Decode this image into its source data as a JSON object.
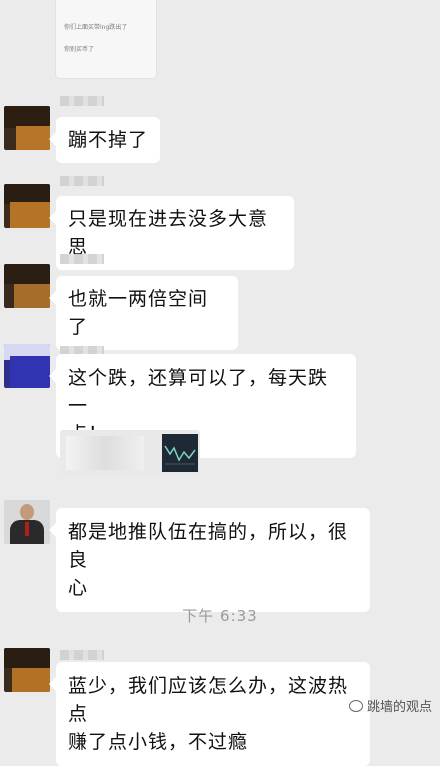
{
  "top_image": {
    "line1": "你们上面买带ing跌出了",
    "line2": "你别买币了"
  },
  "messages": [
    {
      "text": "蹦不掉了"
    },
    {
      "text": "只是现在进去没多大意思"
    },
    {
      "text": "也就一两倍空间了"
    },
    {
      "line1": "这个跌，还算可以了，每天跌一",
      "line2": "点！"
    },
    {
      "line1": "都是地推队伍在搞的，所以，很良",
      "line2": "心"
    },
    {
      "line1": "蓝少，我们应该怎么办，这波热点",
      "line2": "赚了点小钱，不过瘾"
    }
  ],
  "timestamp": "下午 6:33",
  "watermark": "跳墙的观点"
}
